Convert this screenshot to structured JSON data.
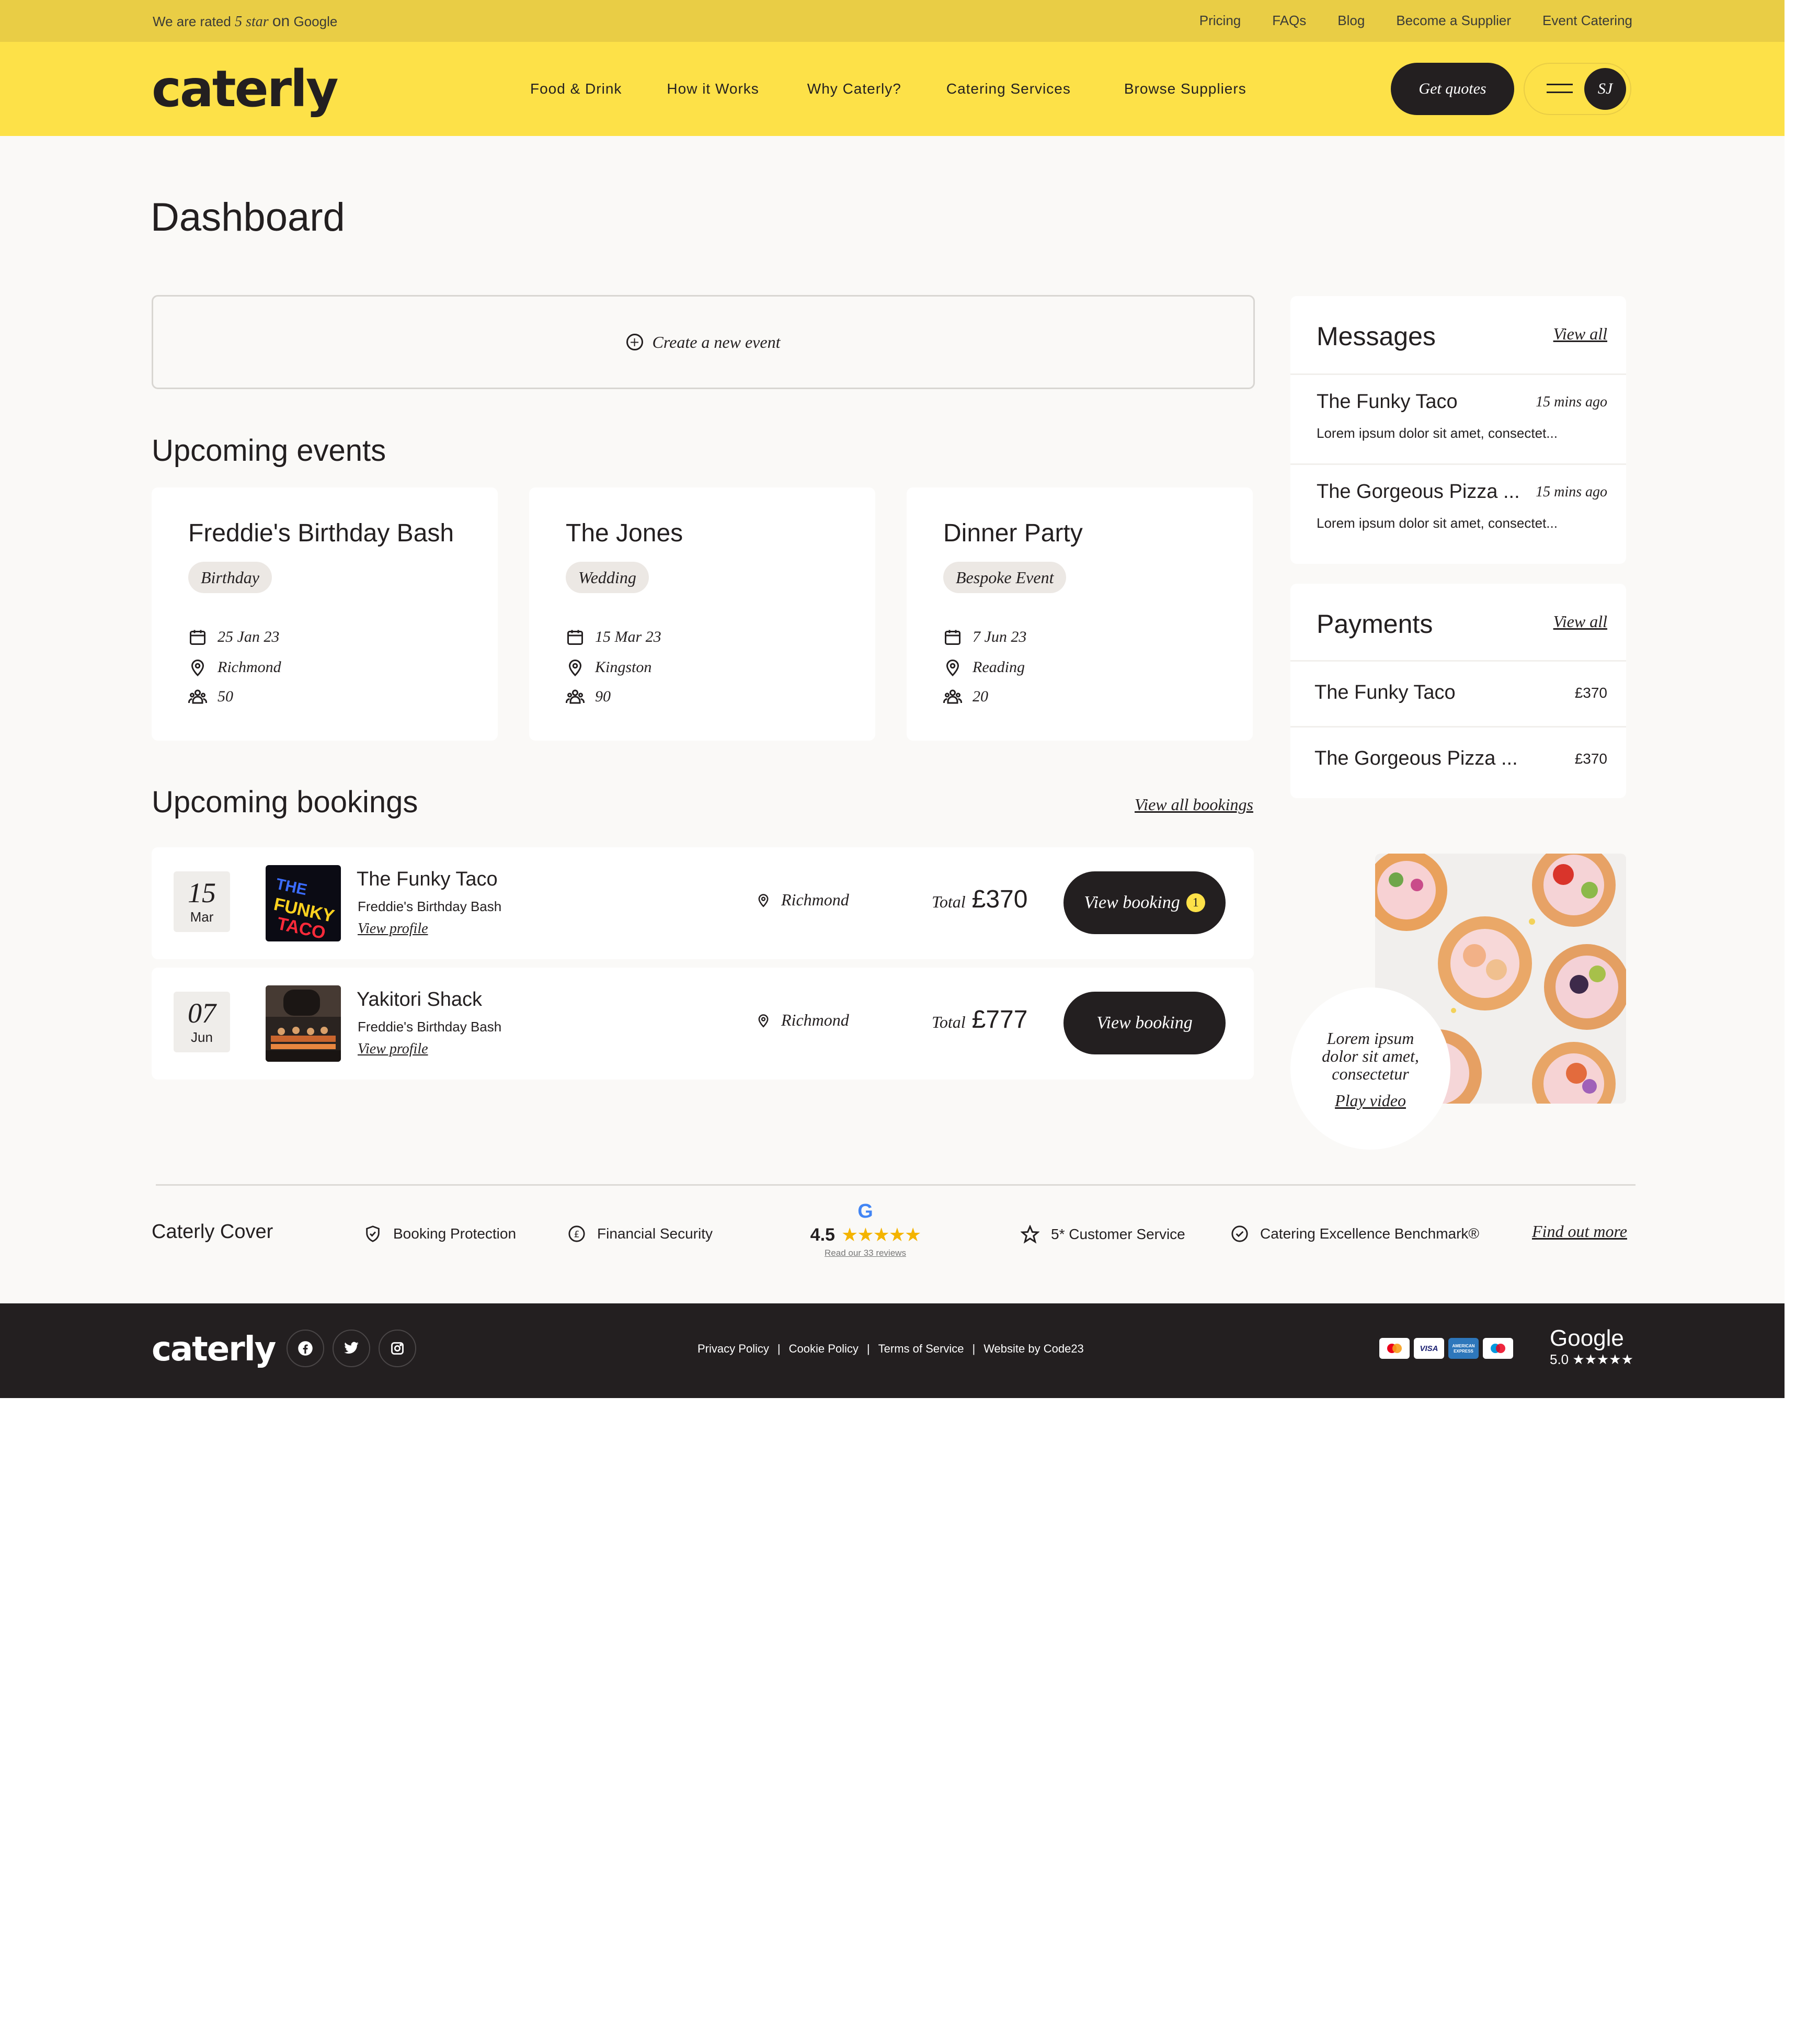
{
  "topbar": {
    "rating_prefix": "We are rated",
    "rating_star": "5 star",
    "rating_on": "on",
    "rating_suffix": "Google",
    "links": [
      "Pricing",
      "FAQs",
      "Blog",
      "Become a Supplier",
      "Event Catering"
    ]
  },
  "header": {
    "logo": "caterly",
    "nav": [
      "Food & Drink",
      "How it Works",
      "Why Caterly?",
      "Catering Services",
      "Browse Suppliers"
    ],
    "quotes_button": "Get quotes",
    "avatar_initials": "SJ"
  },
  "page_title": "Dashboard",
  "create_event": "Create a new event",
  "events": {
    "heading": "Upcoming events",
    "items": [
      {
        "name": "Freddie's Birthday Bash",
        "tag": "Birthday",
        "date": "25 Jan 23",
        "location": "Richmond",
        "guests": "50"
      },
      {
        "name": "The Jones",
        "tag": "Wedding",
        "date": "15 Mar 23",
        "location": "Kingston",
        "guests": "90"
      },
      {
        "name": "Dinner Party",
        "tag": "Bespoke Event",
        "date": "7 Jun 23",
        "location": "Reading",
        "guests": "20"
      }
    ]
  },
  "bookings": {
    "heading": "Upcoming bookings",
    "view_all": "View all bookings",
    "items": [
      {
        "day": "15",
        "month": "Mar",
        "supplier": "The Funky Taco",
        "event": "Freddie's Birthday Bash",
        "profile": "View profile",
        "location": "Richmond",
        "total_label": "Total",
        "total": "£370",
        "button": "View booking",
        "badge": "1"
      },
      {
        "day": "07",
        "month": "Jun",
        "supplier": "Yakitori Shack",
        "event": "Freddie's Birthday Bash",
        "profile": "View profile",
        "location": "Richmond",
        "total_label": "Total",
        "total": "£777",
        "button": "View booking"
      }
    ]
  },
  "messages": {
    "heading": "Messages",
    "view_all": "View all",
    "items": [
      {
        "name": "The Funky Taco",
        "time": "15 mins ago",
        "preview": "Lorem ipsum dolor sit amet, consectet..."
      },
      {
        "name": "The Gorgeous Pizza ...",
        "time": "15 mins ago",
        "preview": "Lorem ipsum dolor sit amet, consectet..."
      }
    ]
  },
  "payments": {
    "heading": "Payments",
    "view_all": "View all",
    "items": [
      {
        "name": "The Funky Taco",
        "amount": "£370"
      },
      {
        "name": "The Gorgeous Pizza ...",
        "amount": "£370"
      }
    ]
  },
  "video": {
    "text_line1": "Lorem ipsum",
    "text_line2": "dolor sit amet,",
    "text_line3": "consectetur",
    "play": "Play video"
  },
  "cover": {
    "title": "Caterly Cover",
    "items": [
      "Booking Protection",
      "Financial Security",
      "5* Customer Service",
      "Catering Excellence Benchmark®"
    ],
    "rating": "4.5",
    "reviews": "Read our 33 reviews",
    "find_out": "Find out more"
  },
  "footer": {
    "logo": "caterly",
    "links": [
      "Privacy Policy",
      "Cookie Policy",
      "Terms of Service",
      "Website by Code23"
    ],
    "google_label": "Google",
    "google_rating": "5.0 ★★★★★"
  },
  "colors": {
    "brand_yellow": "#fde148",
    "topbar_yellow": "#e9cd45",
    "dark": "#231f20",
    "background": "#faf9f7"
  }
}
